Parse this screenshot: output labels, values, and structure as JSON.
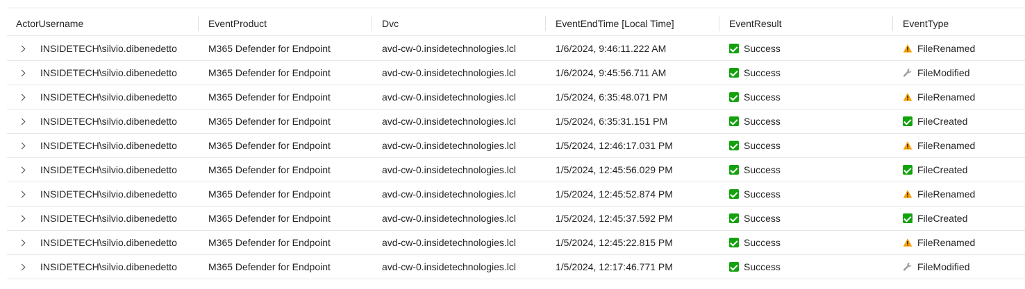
{
  "columns": [
    "ActorUsername",
    "EventProduct",
    "Dvc",
    "EventEndTime [Local Time]",
    "EventResult",
    "EventType"
  ],
  "rows": [
    {
      "actor": "INSIDETECH\\silvio.dibenedetto",
      "product": "M365 Defender for Endpoint",
      "dvc": "avd-cw-0.insidetechnologies.lcl",
      "time": "1/6/2024, 9:46:11.222 AM",
      "result": "Success",
      "result_icon": "check-icon",
      "type": "FileRenamed",
      "type_icon": "warning-icon"
    },
    {
      "actor": "INSIDETECH\\silvio.dibenedetto",
      "product": "M365 Defender for Endpoint",
      "dvc": "avd-cw-0.insidetechnologies.lcl",
      "time": "1/6/2024, 9:45:56.711 AM",
      "result": "Success",
      "result_icon": "check-icon",
      "type": "FileModified",
      "type_icon": "wrench-icon"
    },
    {
      "actor": "INSIDETECH\\silvio.dibenedetto",
      "product": "M365 Defender for Endpoint",
      "dvc": "avd-cw-0.insidetechnologies.lcl",
      "time": "1/5/2024, 6:35:48.071 PM",
      "result": "Success",
      "result_icon": "check-icon",
      "type": "FileRenamed",
      "type_icon": "warning-icon"
    },
    {
      "actor": "INSIDETECH\\silvio.dibenedetto",
      "product": "M365 Defender for Endpoint",
      "dvc": "avd-cw-0.insidetechnologies.lcl",
      "time": "1/5/2024, 6:35:31.151 PM",
      "result": "Success",
      "result_icon": "check-icon",
      "type": "FileCreated",
      "type_icon": "check-icon"
    },
    {
      "actor": "INSIDETECH\\silvio.dibenedetto",
      "product": "M365 Defender for Endpoint",
      "dvc": "avd-cw-0.insidetechnologies.lcl",
      "time": "1/5/2024, 12:46:17.031 PM",
      "result": "Success",
      "result_icon": "check-icon",
      "type": "FileRenamed",
      "type_icon": "warning-icon"
    },
    {
      "actor": "INSIDETECH\\silvio.dibenedetto",
      "product": "M365 Defender for Endpoint",
      "dvc": "avd-cw-0.insidetechnologies.lcl",
      "time": "1/5/2024, 12:45:56.029 PM",
      "result": "Success",
      "result_icon": "check-icon",
      "type": "FileCreated",
      "type_icon": "check-icon"
    },
    {
      "actor": "INSIDETECH\\silvio.dibenedetto",
      "product": "M365 Defender for Endpoint",
      "dvc": "avd-cw-0.insidetechnologies.lcl",
      "time": "1/5/2024, 12:45:52.874 PM",
      "result": "Success",
      "result_icon": "check-icon",
      "type": "FileRenamed",
      "type_icon": "warning-icon"
    },
    {
      "actor": "INSIDETECH\\silvio.dibenedetto",
      "product": "M365 Defender for Endpoint",
      "dvc": "avd-cw-0.insidetechnologies.lcl",
      "time": "1/5/2024, 12:45:37.592 PM",
      "result": "Success",
      "result_icon": "check-icon",
      "type": "FileCreated",
      "type_icon": "check-icon"
    },
    {
      "actor": "INSIDETECH\\silvio.dibenedetto",
      "product": "M365 Defender for Endpoint",
      "dvc": "avd-cw-0.insidetechnologies.lcl",
      "time": "1/5/2024, 12:45:22.815 PM",
      "result": "Success",
      "result_icon": "check-icon",
      "type": "FileRenamed",
      "type_icon": "warning-icon"
    },
    {
      "actor": "INSIDETECH\\silvio.dibenedetto",
      "product": "M365 Defender for Endpoint",
      "dvc": "avd-cw-0.insidetechnologies.lcl",
      "time": "1/5/2024, 12:17:46.771 PM",
      "result": "Success",
      "result_icon": "check-icon",
      "type": "FileModified",
      "type_icon": "wrench-icon"
    }
  ],
  "colors": {
    "success_green": "#13a10e",
    "warning_orange": "#f7a000",
    "wrench_gray": "#9a9a9a",
    "row_border": "#e6e6e6"
  }
}
